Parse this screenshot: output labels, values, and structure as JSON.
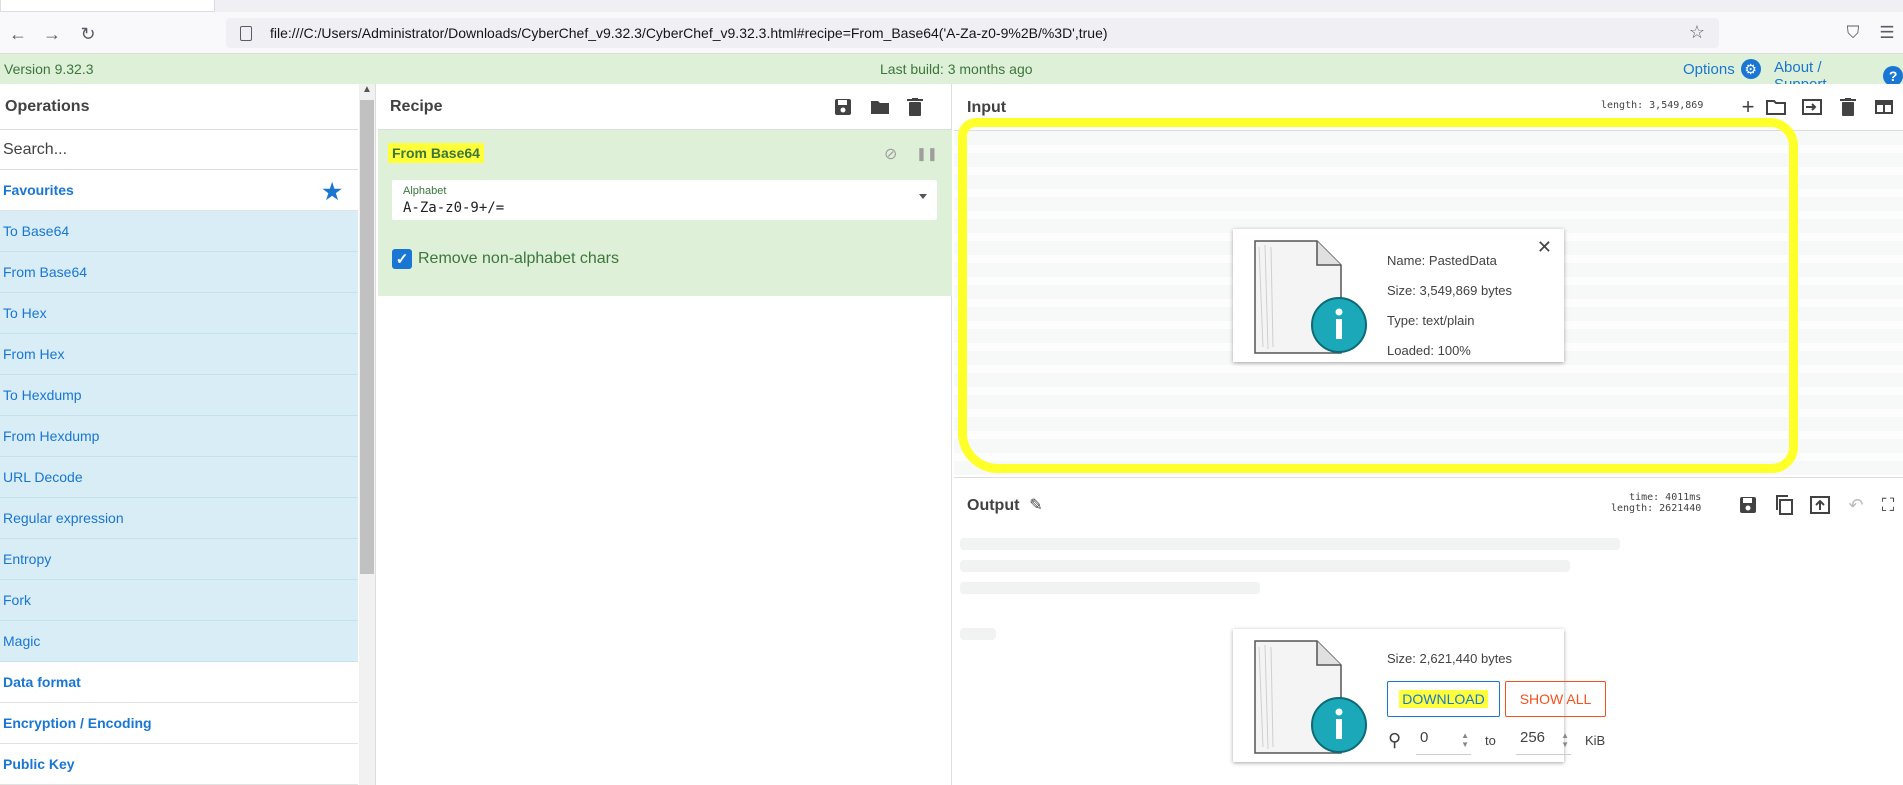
{
  "browser": {
    "url": "file:///C:/Users/Administrator/Downloads/CyberChef_v9.32.3/CyberChef_v9.32.3.html#recipe=From_Base64('A-Za-z0-9%2B/%3D',true)"
  },
  "banner": {
    "version": "Version 9.32.3",
    "last_build": "Last build: 3 months ago",
    "options": "Options",
    "about": "About / Support"
  },
  "operations": {
    "title": "Operations",
    "search_placeholder": "Search...",
    "favourites_label": "Favourites",
    "favourites": [
      "To Base64",
      "From Base64",
      "To Hex",
      "From Hex",
      "To Hexdump",
      "From Hexdump",
      "URL Decode",
      "Regular expression",
      "Entropy",
      "Fork",
      "Magic"
    ],
    "categories": [
      "Data format",
      "Encryption / Encoding",
      "Public Key"
    ]
  },
  "recipe": {
    "title": "Recipe",
    "operation": {
      "name": "From Base64",
      "alphabet_label": "Alphabet",
      "alphabet_value": "A-Za-z0-9+/=",
      "remove_label": "Remove non-alphabet chars",
      "remove_checked": true
    }
  },
  "input": {
    "title": "Input",
    "length_label": "length: 3,549,869",
    "file": {
      "name": "Name: PastedData",
      "size": "Size: 3,549,869 bytes",
      "type": "Type: text/plain",
      "loaded": "Loaded: 100%"
    }
  },
  "output": {
    "title": "Output",
    "time_label": "time:  4011ms",
    "length_label": "length: 2621440",
    "file": {
      "size": "Size: 2,621,440 bytes",
      "download": "DOWNLOAD",
      "show_all": "SHOW ALL",
      "range_from": "0",
      "range_to_label": "to",
      "range_to": "256",
      "unit": "KiB"
    }
  },
  "colors": {
    "accent": "#1976d2",
    "banner_bg": "#dff0d8",
    "banner_text": "#3c763d",
    "favourite_bg": "#d9edf7",
    "highlight": "#ffff2a",
    "show_all": "#f4511e",
    "file_icon": "#1ba8b8"
  }
}
